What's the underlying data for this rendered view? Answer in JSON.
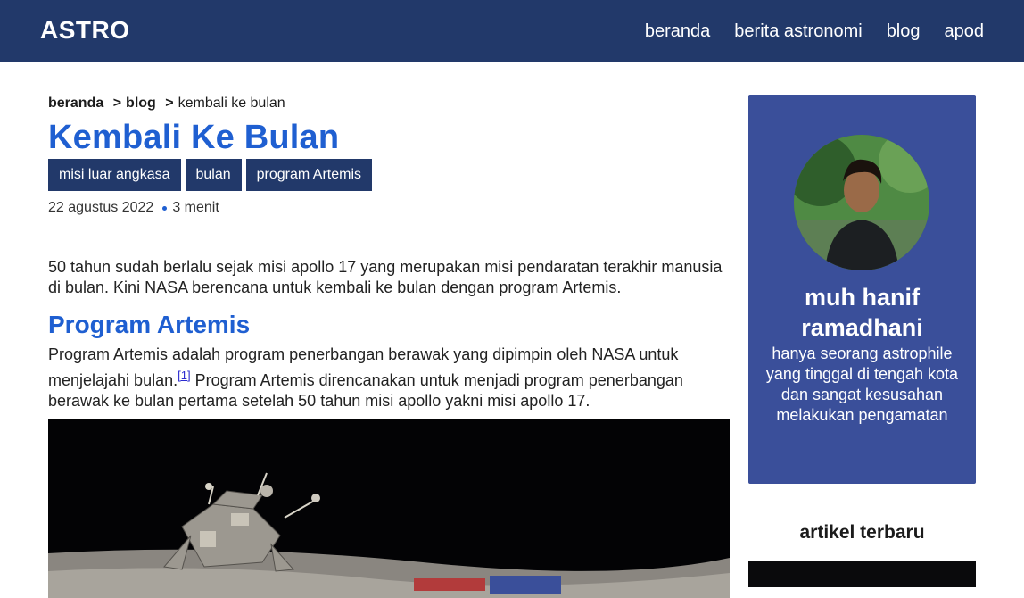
{
  "header": {
    "brand": "ASTRO",
    "nav": [
      "beranda",
      "berita astronomi",
      "blog",
      "apod"
    ]
  },
  "breadcrumb": {
    "items": [
      "beranda",
      "blog"
    ],
    "current": "kembali ke bulan",
    "separator": ">"
  },
  "article": {
    "title": "Kembali Ke Bulan",
    "tags": [
      "misi luar angkasa",
      "bulan",
      "program Artemis"
    ],
    "date": "22 agustus 2022",
    "read_time": "3 menit",
    "intro": "50 tahun sudah berlalu sejak misi apollo 17 yang merupakan misi pendaratan terakhir manusia di bulan. Kini NASA berencana untuk kembali ke bulan dengan program Artemis.",
    "section_title": "Program Artemis",
    "section_text_1": "Program Artemis adalah program penerbangan berawak yang dipimpin oleh NASA untuk menjelajahi bulan.",
    "citation": "[1]",
    "section_text_2": " Program Artemis direncanakan untuk menjadi program penerbangan berawak ke bulan pertama setelah 50 tahun misi apollo yakni misi apollo 17."
  },
  "profile": {
    "name": "muh hanif ramadhani",
    "bio": "hanya seorang astrophile yang tinggal di tengah kota dan sangat kesusahan melakukan pengamatan"
  },
  "latest": {
    "title": "artikel terbaru"
  },
  "colors": {
    "header_bg": "#22396a",
    "accent": "#1f5fd1",
    "card_bg": "#3a4f9a"
  }
}
